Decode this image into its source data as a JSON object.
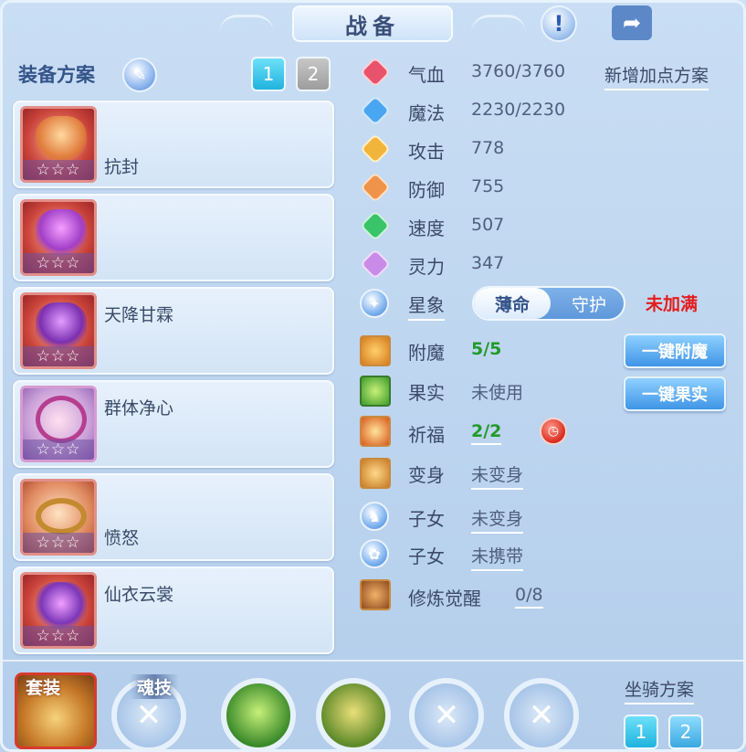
{
  "header": {
    "title": "战备",
    "info_icon": "info-icon",
    "share_icon": "share-icon"
  },
  "left_panel": {
    "title": "装备方案",
    "pages": [
      "1",
      "2"
    ],
    "active_page": "1",
    "slots": [
      {
        "name": "抗封",
        "stars": "☆☆☆",
        "icon": "bow-equipment-icon"
      },
      {
        "name": "",
        "stars": "☆☆☆",
        "icon": "helmet-equipment-icon"
      },
      {
        "name": "天降甘霖",
        "stars": "☆☆☆",
        "icon": "armor-equipment-icon"
      },
      {
        "name": "群体净心",
        "stars": "☆☆☆",
        "icon": "necklace-equipment-icon"
      },
      {
        "name": "愤怒",
        "stars": "☆☆☆",
        "icon": "belt-equipment-icon"
      },
      {
        "name": "仙衣云裳",
        "stars": "☆☆☆",
        "icon": "boots-equipment-icon"
      }
    ]
  },
  "stats": [
    {
      "label": "气血",
      "value": "3760/3760",
      "icon": "heart-icon",
      "color": "#e8526a"
    },
    {
      "label": "魔法",
      "value": "2230/2230",
      "icon": "mana-icon",
      "color": "#4aa6f0"
    },
    {
      "label": "攻击",
      "value": "778",
      "icon": "attack-icon",
      "color": "#f2b53b"
    },
    {
      "label": "防御",
      "value": "755",
      "icon": "defense-icon",
      "color": "#f0934a"
    },
    {
      "label": "速度",
      "value": "507",
      "icon": "speed-icon",
      "color": "#39c46a"
    },
    {
      "label": "灵力",
      "value": "347",
      "icon": "spirit-icon",
      "color": "#c98be8"
    }
  ],
  "new_plan_label": "新增加点方案",
  "star_sign": {
    "label": "星象",
    "options": [
      "薄命",
      "守护"
    ],
    "selected": "薄命",
    "status": "未加满"
  },
  "enhancements": [
    {
      "label": "附魔",
      "value": "5/5",
      "icon": "enchant-icon"
    },
    {
      "label": "果实",
      "value": "未使用",
      "icon": "fruit-icon"
    },
    {
      "label": "祈福",
      "value": "2/2",
      "icon": "blessing-icon"
    },
    {
      "label": "变身",
      "value": "未变身",
      "icon": "transform-icon"
    },
    {
      "label": "子女",
      "value": "未变身",
      "icon": "child-icon"
    },
    {
      "label": "子女",
      "value": "未携带",
      "icon": "paw-icon"
    },
    {
      "label": "修炼觉醒",
      "value": "0/8",
      "icon": "cultivation-icon"
    }
  ],
  "buttons": {
    "enchant_all": "一键附魔",
    "fruit_all": "一键果实"
  },
  "bottom": {
    "suit_label": "套装",
    "soul_skill_label": "魂技",
    "mount_title": "坐骑方案",
    "mount_pages": [
      "1",
      "2"
    ]
  },
  "colors": {
    "accent": "#1fb3df",
    "warning": "#e31d1d",
    "ok": "#229a2a",
    "panel": "#c9def4"
  }
}
